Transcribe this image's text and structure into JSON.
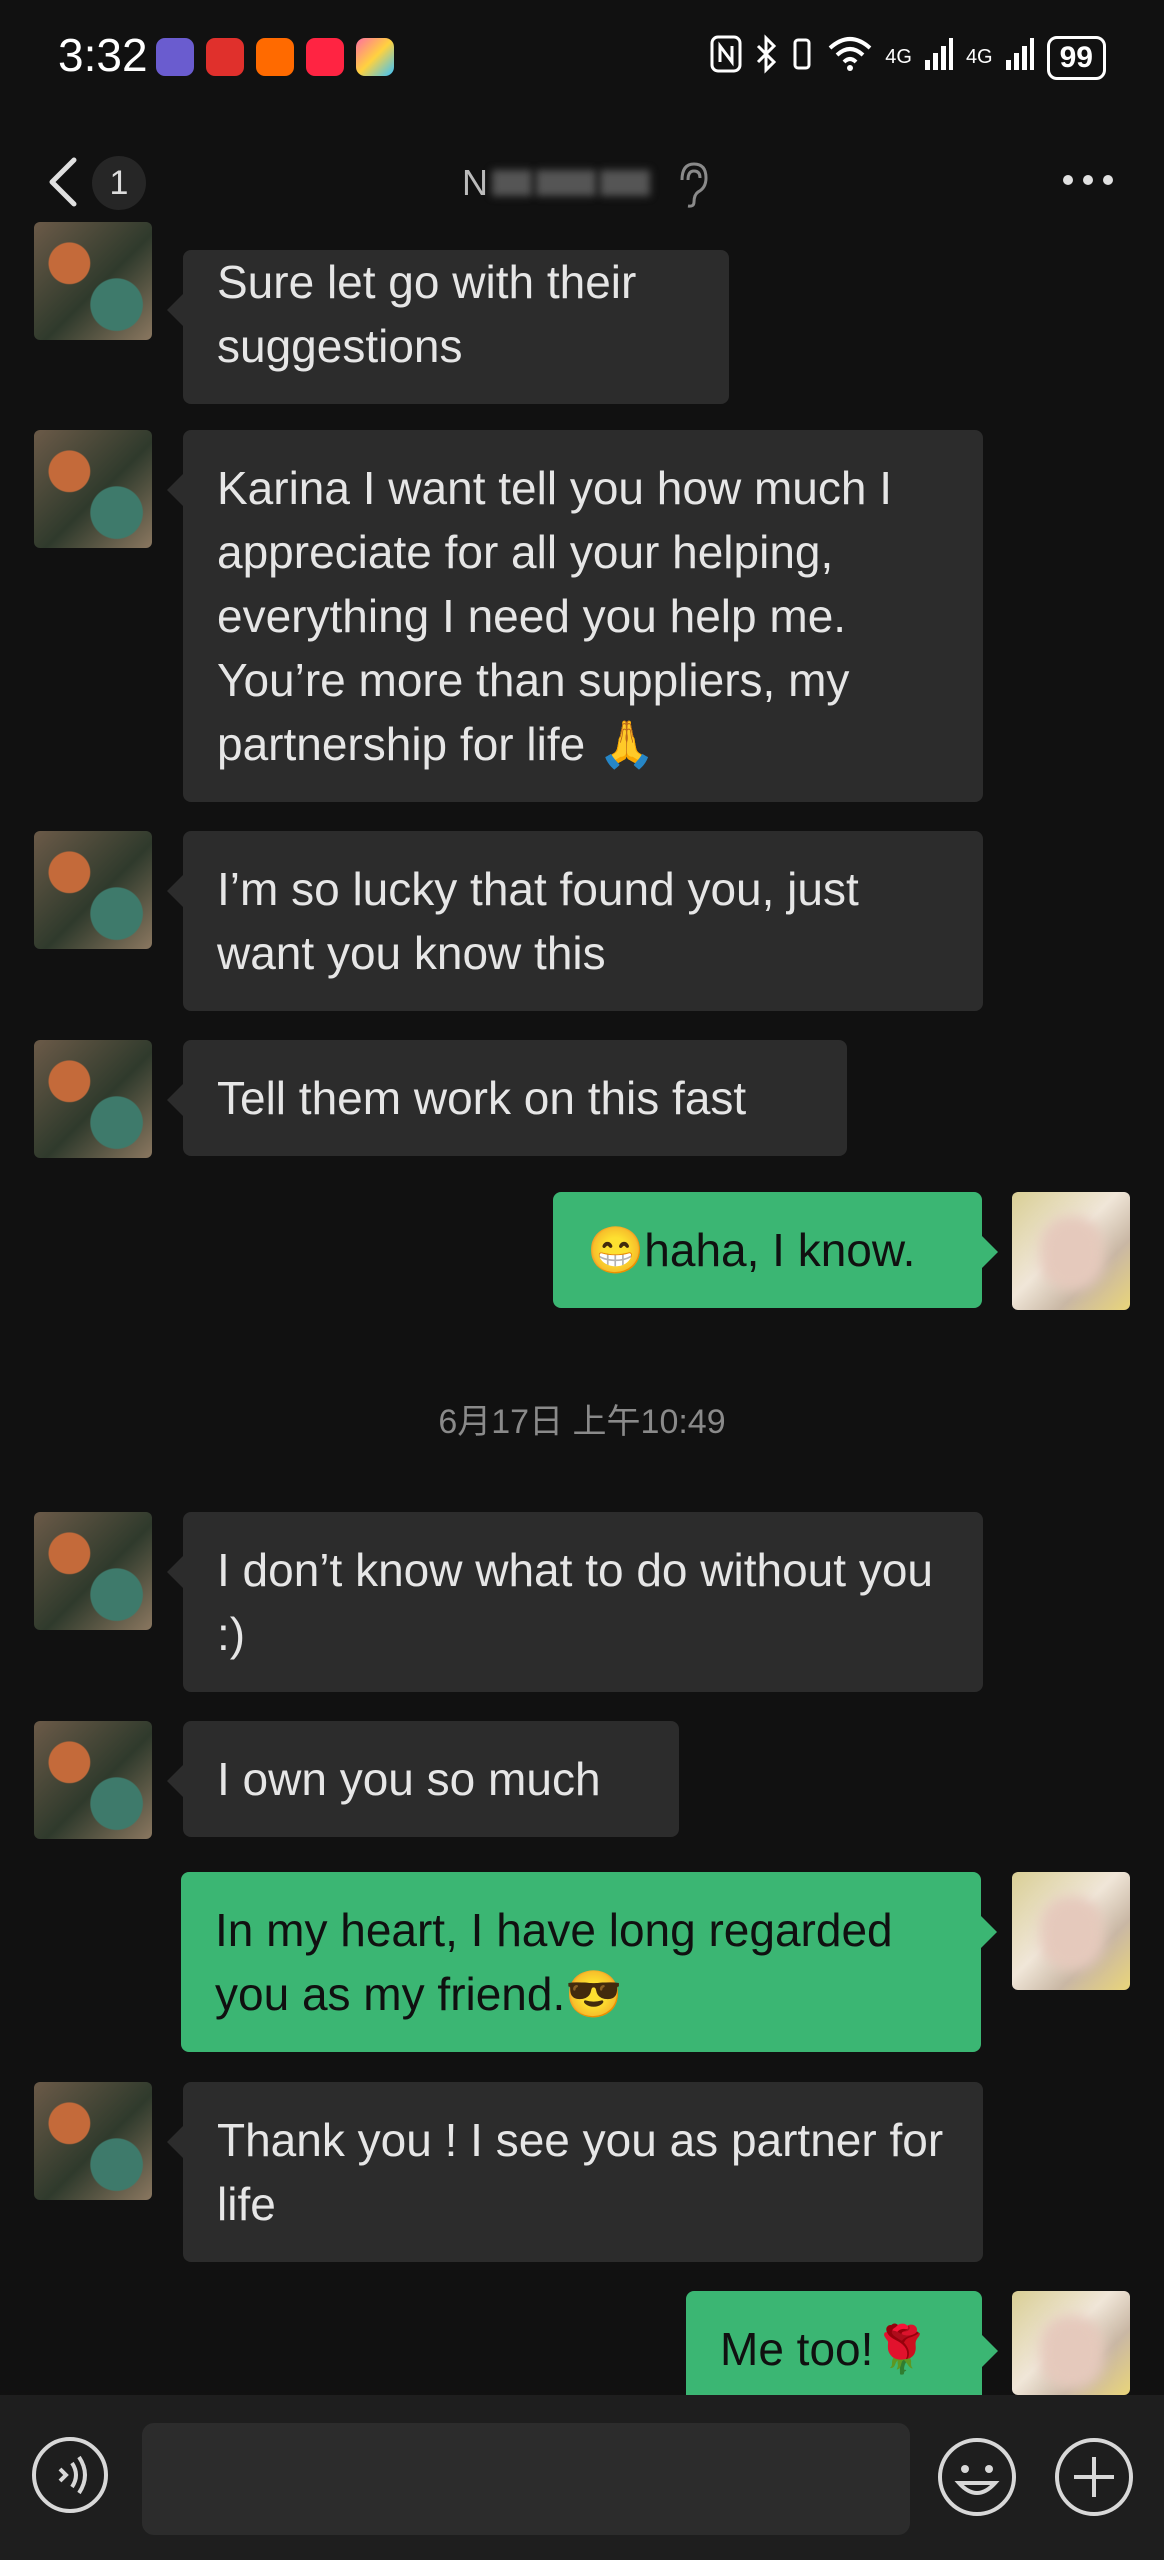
{
  "status_bar": {
    "time": "3:32",
    "battery": "99",
    "network_1": "4G",
    "network_2": "4G"
  },
  "header": {
    "unread_count": "1",
    "title_fragment": "N"
  },
  "messages": [
    {
      "side": "in",
      "text": "Sure let go with their suggestions"
    },
    {
      "side": "in",
      "text": "Karina I want tell you how much I appreciate for all your helping, everything I need you help me. You’re more than suppliers, my partnership for life 🙏"
    },
    {
      "side": "in",
      "text": "I’m so lucky that found you, just want you know this"
    },
    {
      "side": "in",
      "text": "Tell them work on this fast"
    },
    {
      "side": "out",
      "text": "😁haha, I know."
    },
    {
      "side": "in",
      "text": "I don’t know what to do without you :)"
    },
    {
      "side": "in",
      "text": "I own you so much"
    },
    {
      "side": "out",
      "text": "In my heart, I have long regarded you as my friend.😎"
    },
    {
      "side": "in",
      "text": "Thank you ! I see you as partner for life"
    },
    {
      "side": "out",
      "text": "Me too!🌹"
    }
  ],
  "timestamp": "6月17日 上午10:49",
  "colors": {
    "background": "#111111",
    "incoming_bubble": "#2c2c2c",
    "outgoing_bubble": "#3bb673",
    "input_bar": "#1e1e1e"
  },
  "icons": {
    "back": "chevron-left-icon",
    "ear": "ear-icon",
    "more": "more-dots-icon",
    "voice": "voice-icon",
    "emoji": "emoji-icon",
    "plus": "plus-icon"
  }
}
